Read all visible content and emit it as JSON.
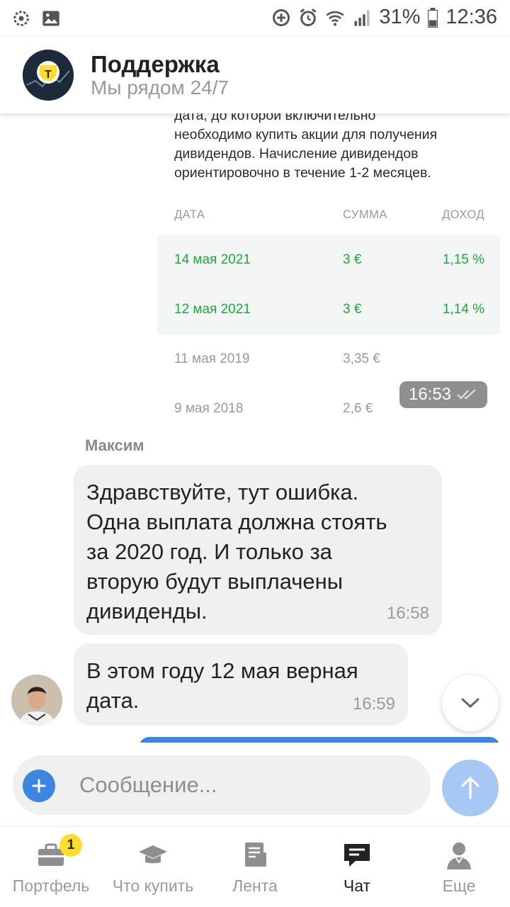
{
  "status_bar": {
    "battery": "31%",
    "time": "12:36",
    "icons": [
      "settings-icon",
      "gallery-icon",
      "data-saver-icon",
      "alarm-icon",
      "wifi-icon",
      "signal-icon",
      "battery-icon"
    ]
  },
  "header": {
    "title": "Поддержка",
    "subtitle": "Мы рядом 24/7",
    "avatar_icon": "bank-logo-icon"
  },
  "bot_message": {
    "text_lines": [
      "дата, до которой включительно",
      "необходимо купить акции для получения",
      "дивидендов. Начисление дивидендов",
      "ориентировочно в течение 1-2 месяцев."
    ],
    "table": {
      "headers": {
        "date": "ДАТА",
        "sum": "СУММА",
        "income": "ДОХОД"
      },
      "rows": [
        {
          "date": "14 мая 2021",
          "sum": "3 €",
          "income": "1,15 %",
          "highlight": true
        },
        {
          "date": "12 мая 2021",
          "sum": "3 €",
          "income": "1,14 %",
          "highlight": true
        },
        {
          "date": "11 мая 2019",
          "sum": "3,35 €",
          "income": "",
          "highlight": false
        },
        {
          "date": "9 мая 2018",
          "sum": "2,6 €",
          "income": "",
          "highlight": false
        }
      ]
    },
    "time": "16:53"
  },
  "user_messages": {
    "sender": "Максим",
    "messages": [
      {
        "lines": [
          "Здравствуйте, тут ошибка.",
          "Одна выплата должна стоять",
          "за 2020 год. И только за",
          "вторую будут выплачены",
          "дивиденды."
        ],
        "time": "16:58"
      },
      {
        "lines": [
          "В этом году 12 мая верная",
          "дата."
        ],
        "time": "16:59"
      }
    ]
  },
  "composer": {
    "placeholder": "Сообщение..."
  },
  "bottom_nav": {
    "items": [
      {
        "label": "Портфель",
        "icon": "briefcase-icon",
        "badge": "1"
      },
      {
        "label": "Что купить",
        "icon": "graduation-cap-icon"
      },
      {
        "label": "Лента",
        "icon": "feed-icon"
      },
      {
        "label": "Чат",
        "icon": "chat-icon",
        "active": true
      },
      {
        "label": "Еще",
        "icon": "profile-icon"
      }
    ]
  },
  "colors": {
    "accent_blue": "#3d86e0",
    "send_button": "#a7c8f2",
    "positive_green": "#1aaa3c",
    "badge_yellow": "#ffdd2d"
  }
}
